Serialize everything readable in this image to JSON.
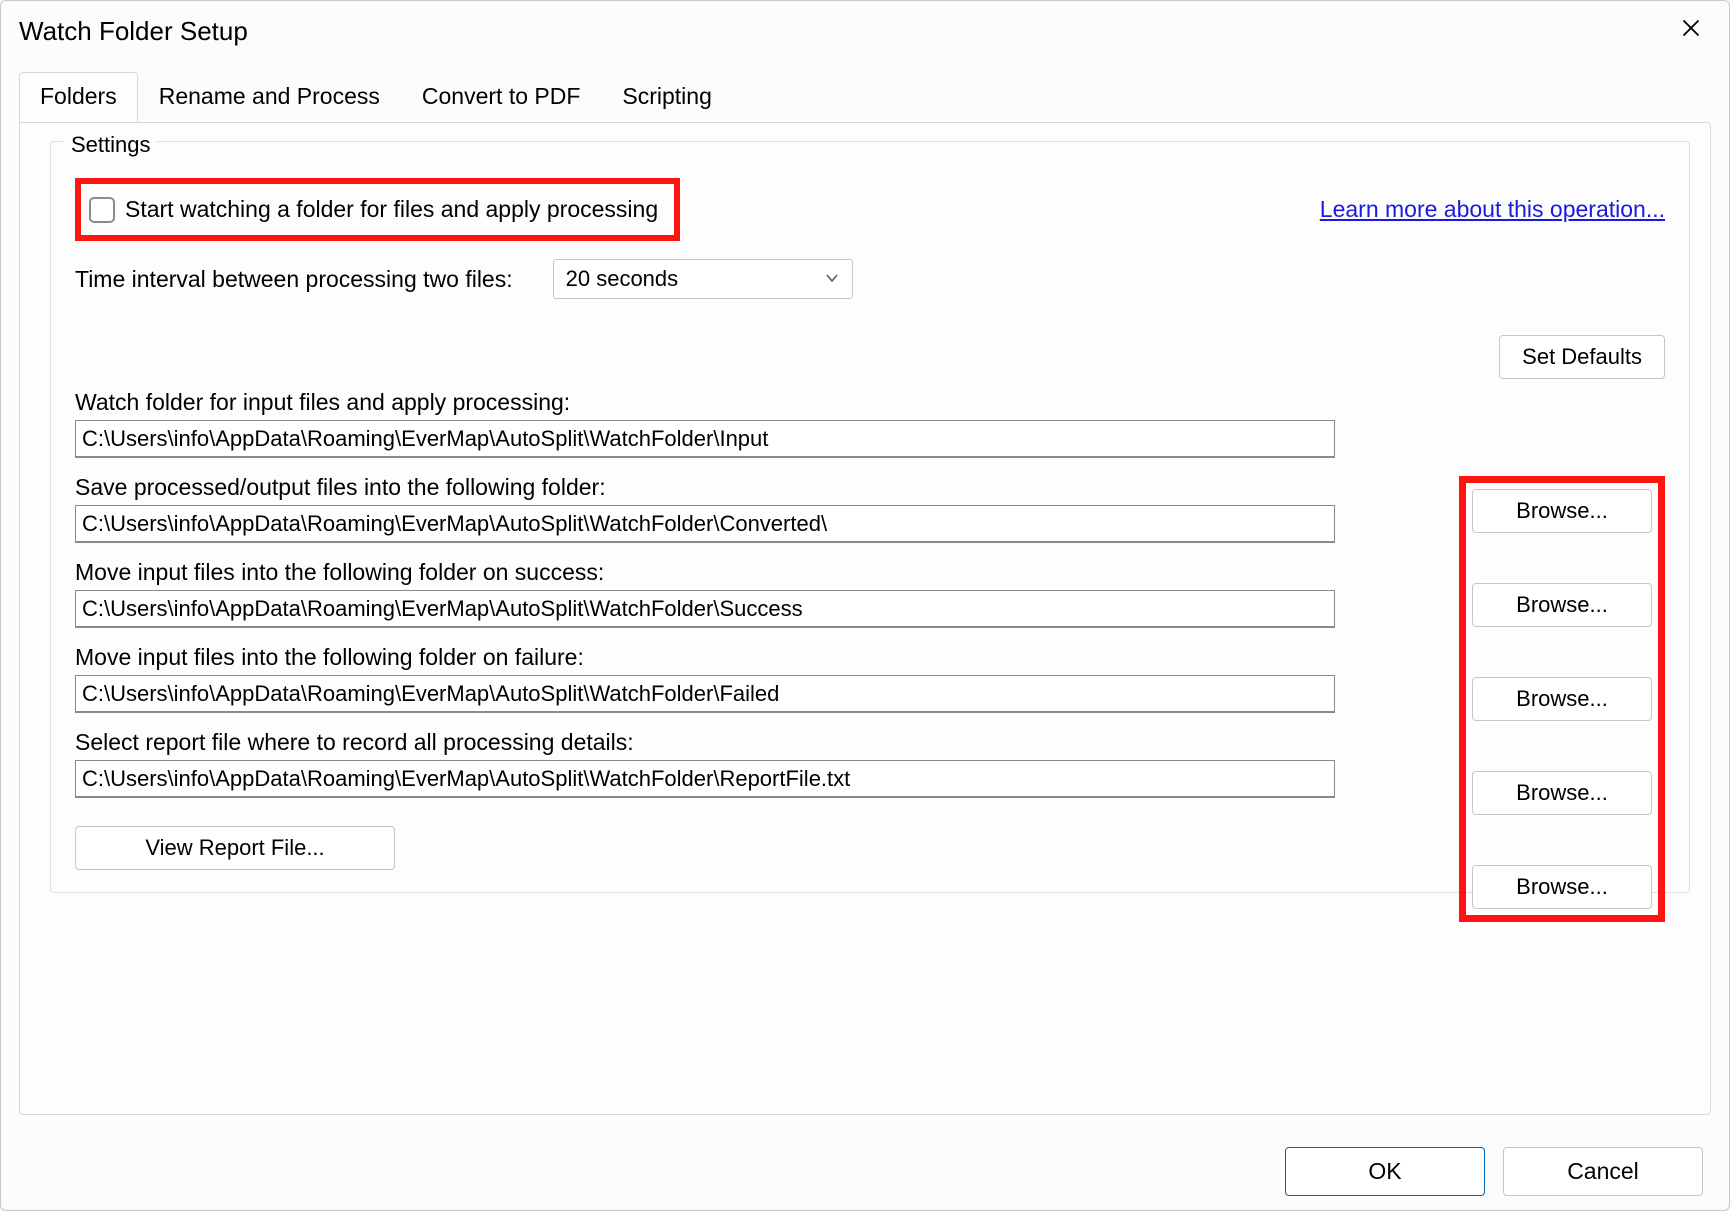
{
  "dialog": {
    "title": "Watch Folder Setup"
  },
  "tabs": {
    "folders": "Folders",
    "rename": "Rename and Process",
    "convert": "Convert to PDF",
    "scripting": "Scripting"
  },
  "settings": {
    "group_title": "Settings",
    "start_watch_label": "Start watching a folder for files and apply processing",
    "learn_more": "Learn more about this operation...",
    "interval_label": "Time interval between processing two files:",
    "interval_value": "20 seconds",
    "set_defaults": "Set Defaults",
    "browse_label": "Browse...",
    "view_report": "View Report File...",
    "fields": {
      "input": {
        "label": "Watch folder for input files and apply processing:",
        "value": "C:\\Users\\info\\AppData\\Roaming\\EverMap\\AutoSplit\\WatchFolder\\Input"
      },
      "output": {
        "label": "Save processed/output files into the following folder:",
        "value": "C:\\Users\\info\\AppData\\Roaming\\EverMap\\AutoSplit\\WatchFolder\\Converted\\"
      },
      "success": {
        "label": "Move input files into the following folder on success:",
        "value": "C:\\Users\\info\\AppData\\Roaming\\EverMap\\AutoSplit\\WatchFolder\\Success"
      },
      "failure": {
        "label": "Move input files into the following folder on failure:",
        "value": "C:\\Users\\info\\AppData\\Roaming\\EverMap\\AutoSplit\\WatchFolder\\Failed"
      },
      "report": {
        "label": "Select report file where to record all processing details:",
        "value": "C:\\Users\\info\\AppData\\Roaming\\EverMap\\AutoSplit\\WatchFolder\\ReportFile.txt"
      }
    }
  },
  "footer": {
    "ok": "OK",
    "cancel": "Cancel"
  }
}
